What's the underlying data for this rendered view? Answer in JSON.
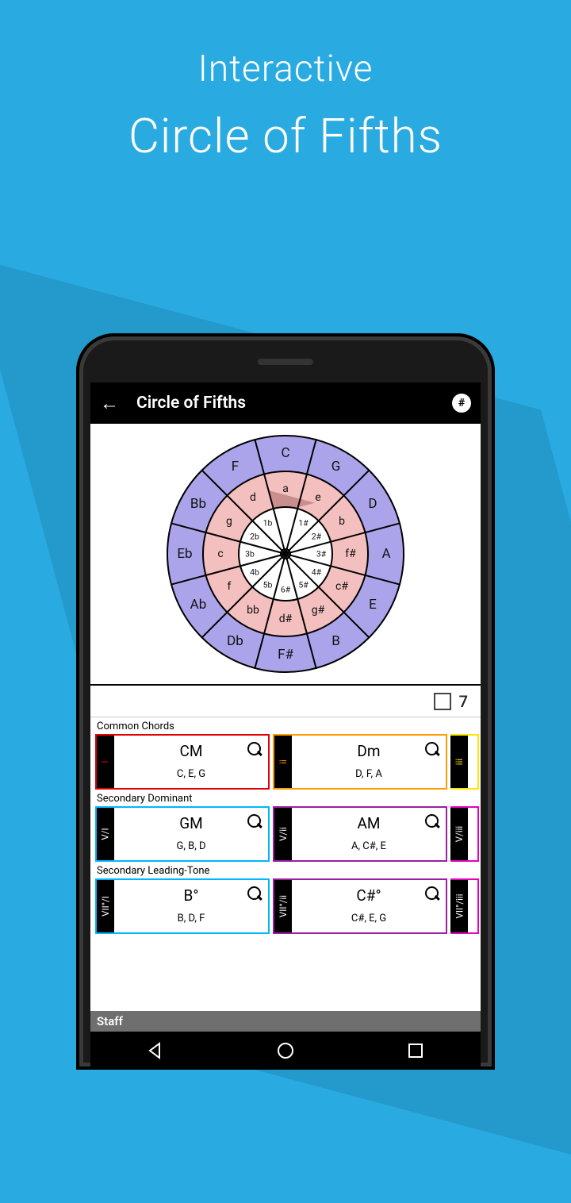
{
  "promo": {
    "line1": "Interactive",
    "line2": "Circle of Fifths"
  },
  "appbar": {
    "title": "Circle of Fifths",
    "sharp_symbol": "#"
  },
  "wheel": {
    "majors": [
      "C",
      "G",
      "D",
      "A",
      "E",
      "B",
      "F#",
      "Db",
      "Ab",
      "Eb",
      "Bb",
      "F"
    ],
    "minors": [
      "a",
      "e",
      "b",
      "f#",
      "c#",
      "g#",
      "d#",
      "bb",
      "f",
      "c",
      "g",
      "d"
    ],
    "centers": [
      "",
      "1#",
      "2#",
      "3#",
      "4#",
      "5#",
      "6#",
      "5b",
      "4b",
      "3b",
      "2b",
      "1b"
    ],
    "selected_index": 0
  },
  "options": {
    "seventh_label": "7"
  },
  "sections": [
    {
      "label": "Common Chords",
      "cards": [
        {
          "roman": "I",
          "chord": "CM",
          "notes": "C, E, G",
          "color": "c-red"
        },
        {
          "roman": "ii",
          "chord": "Dm",
          "notes": "D, F, A",
          "color": "c-orange"
        },
        {
          "roman": "iii",
          "chord": "",
          "notes": "",
          "color": "c-yellow",
          "cut": true
        }
      ]
    },
    {
      "label": "Secondary Dominant",
      "cards": [
        {
          "roman": "V/I",
          "chord": "GM",
          "notes": "G, B, D",
          "color": "c-cyan"
        },
        {
          "roman": "V/ii",
          "chord": "AM",
          "notes": "A, C#, E",
          "color": "c-purple"
        },
        {
          "roman": "V/iii",
          "chord": "",
          "notes": "",
          "color": "c-mag",
          "cut": true
        }
      ]
    },
    {
      "label": "Secondary Leading-Tone",
      "cards": [
        {
          "roman": "VII°/I",
          "chord": "B°",
          "notes": "B, D, F",
          "color": "c-cyan"
        },
        {
          "roman": "VII°/ii",
          "chord": "C#°",
          "notes": "C#, E, G",
          "color": "c-purple"
        },
        {
          "roman": "VII°/iii",
          "chord": "",
          "notes": "",
          "color": "c-mag",
          "cut": true
        }
      ]
    }
  ],
  "staff_label": "Staff"
}
